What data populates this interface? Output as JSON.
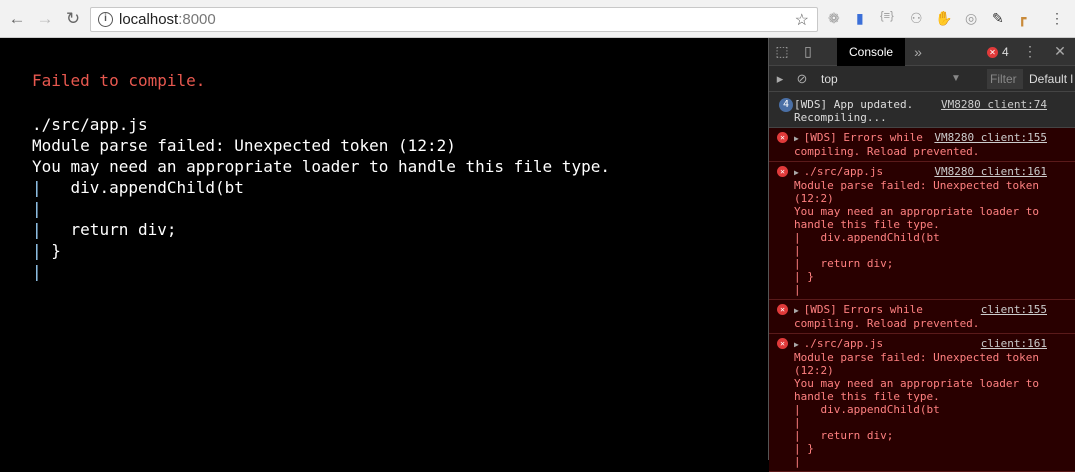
{
  "browser": {
    "host": "localhost",
    "port": ":8000"
  },
  "page": {
    "error_title": "Failed to compile.",
    "lines": [
      "./src/app.js",
      "Module parse failed: Unexpected token (12:2)",
      "You may need an appropriate loader to handle this file type."
    ],
    "code": [
      {
        "pipe": "|",
        "text": "   div.appendChild(bt"
      },
      {
        "pipe": "|",
        "text": ""
      },
      {
        "pipe": "|",
        "text": "   return div;"
      },
      {
        "pipe": "|",
        "text": " }"
      },
      {
        "pipe": "|",
        "text": ""
      }
    ]
  },
  "devtools": {
    "tab": "Console",
    "more": "»",
    "error_count": "4",
    "context": "top",
    "filter": "Filter",
    "levels": "Default l",
    "messages": [
      {
        "type": "info",
        "count": "4",
        "text": "[WDS] App updated.\nRecompiling...",
        "source": "VM8280 client:74"
      },
      {
        "type": "error",
        "text": "[WDS] Errors while\ncompiling. Reload prevented.",
        "source": "VM8280 client:155"
      },
      {
        "type": "error",
        "text": "./src/app.js\nModule parse failed: Unexpected token\n(12:2)\nYou may need an appropriate loader to\nhandle this file type.\n|   div.appendChild(bt\n|\n|   return div;\n| }\n|",
        "source": "VM8280 client:161"
      },
      {
        "type": "error",
        "text": "[WDS] Errors while\ncompiling. Reload prevented.",
        "source": "client:155"
      },
      {
        "type": "error",
        "text": "./src/app.js\nModule parse failed: Unexpected token\n(12:2)\nYou may need an appropriate loader to\nhandle this file type.\n|   div.appendChild(bt\n|\n|   return div;\n| }\n|",
        "source": "client:161"
      }
    ]
  }
}
